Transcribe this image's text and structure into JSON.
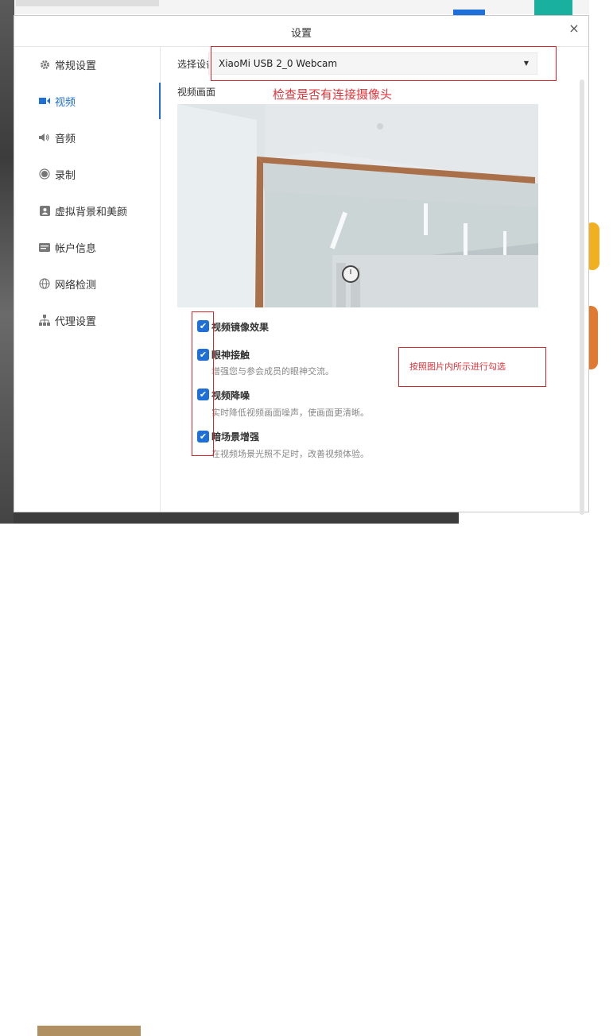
{
  "dialog": {
    "title": "设置",
    "close_glyph": "×"
  },
  "sidebar": {
    "items": [
      {
        "label": "常规设置",
        "icon": "gear-icon",
        "glyph": "⚙"
      },
      {
        "label": "视频",
        "icon": "video-camera-icon",
        "glyph": "■",
        "active": true
      },
      {
        "label": "音频",
        "icon": "speaker-icon",
        "glyph": "🔈"
      },
      {
        "label": "录制",
        "icon": "record-icon",
        "glyph": "●"
      },
      {
        "label": "虚拟背景和美颜",
        "icon": "portrait-icon",
        "glyph": "▣"
      },
      {
        "label": "帐户信息",
        "icon": "id-card-icon",
        "glyph": "▭"
      },
      {
        "label": "网络检测",
        "icon": "globe-icon",
        "glyph": "⊕"
      },
      {
        "label": "代理设置",
        "icon": "network-icon",
        "glyph": "⋔"
      }
    ]
  },
  "video": {
    "device_label": "选择设备",
    "device_value": "XiaoMi USB 2_0 Webcam",
    "preview_label": "视频画面"
  },
  "annotations": {
    "top_note": "检查是否有连接摄像头",
    "side_note": "按照图片内所示进行勾选"
  },
  "options": [
    {
      "title": "视频镜像效果",
      "desc": "",
      "checked": true
    },
    {
      "title": "眼神接触",
      "desc": "增强您与参会成员的眼神交流。",
      "checked": true
    },
    {
      "title": "视频降噪",
      "desc": "实时降低视频画面噪声，使画面更清晰。",
      "checked": true
    },
    {
      "title": "暗场景增强",
      "desc": "在视频场景光照不足时，改善视频体验。",
      "checked": true
    }
  ],
  "colors": {
    "accent": "#1f6fd6",
    "annotation": "#d9262c"
  }
}
